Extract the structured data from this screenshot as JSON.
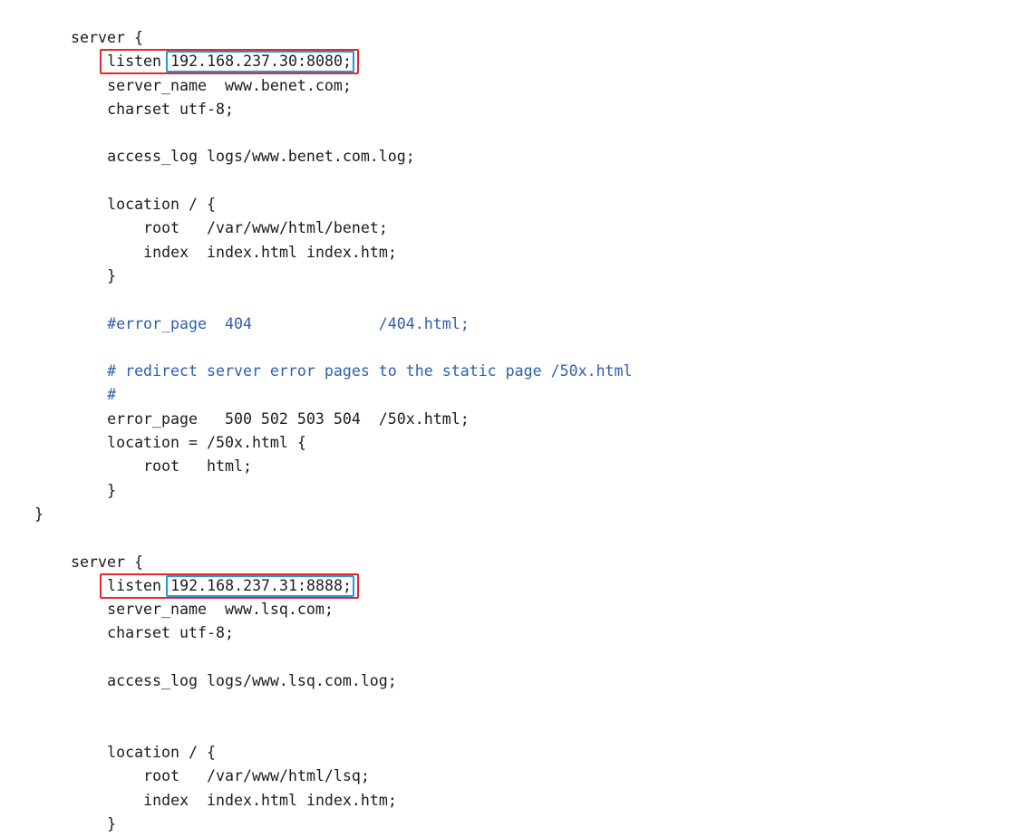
{
  "lines": [
    {
      "indent": 6,
      "text": "server {"
    },
    {
      "indent": 10,
      "text": "listen",
      "value": "192.168.237.30:8080;",
      "highlight": true
    },
    {
      "indent": 10,
      "text": "server_name  www.benet.com;"
    },
    {
      "indent": 10,
      "text": "charset utf-8;"
    },
    {
      "indent": 0,
      "text": ""
    },
    {
      "indent": 10,
      "text": "access_log logs/www.benet.com.log;"
    },
    {
      "indent": 0,
      "text": ""
    },
    {
      "indent": 10,
      "text": "location / {"
    },
    {
      "indent": 14,
      "text": "root   /var/www/html/benet;"
    },
    {
      "indent": 14,
      "text": "index  index.html index.htm;"
    },
    {
      "indent": 10,
      "text": "}"
    },
    {
      "indent": 0,
      "text": ""
    },
    {
      "indent": 10,
      "text": "#error_page  404              /404.html;",
      "comment": true
    },
    {
      "indent": 0,
      "text": ""
    },
    {
      "indent": 10,
      "text": "# redirect server error pages to the static page /50x.html",
      "comment": true
    },
    {
      "indent": 10,
      "text": "#",
      "comment": true
    },
    {
      "indent": 10,
      "text": "error_page   500 502 503 504  /50x.html;"
    },
    {
      "indent": 10,
      "text": "location = /50x.html {"
    },
    {
      "indent": 14,
      "text": "root   html;"
    },
    {
      "indent": 10,
      "text": "}"
    },
    {
      "indent": 2,
      "text": "}"
    },
    {
      "indent": 0,
      "text": ""
    },
    {
      "indent": 6,
      "text": "server {"
    },
    {
      "indent": 10,
      "text": "listen",
      "value": "192.168.237.31:8888;",
      "highlight": true
    },
    {
      "indent": 10,
      "text": "server_name  www.lsq.com;"
    },
    {
      "indent": 10,
      "text": "charset utf-8;"
    },
    {
      "indent": 0,
      "text": ""
    },
    {
      "indent": 10,
      "text": "access_log logs/www.lsq.com.log;"
    },
    {
      "indent": 0,
      "text": ""
    },
    {
      "indent": 0,
      "text": ""
    },
    {
      "indent": 10,
      "text": "location / {"
    },
    {
      "indent": 14,
      "text": "root   /var/www/html/lsq;"
    },
    {
      "indent": 14,
      "text": "index  index.html index.htm;"
    },
    {
      "indent": 10,
      "text": "}"
    }
  ],
  "colors": {
    "text": "#1c1c1c",
    "comment": "#2e5fad",
    "outer_box": "#e8262d",
    "inner_box": "#1e9ad6"
  }
}
